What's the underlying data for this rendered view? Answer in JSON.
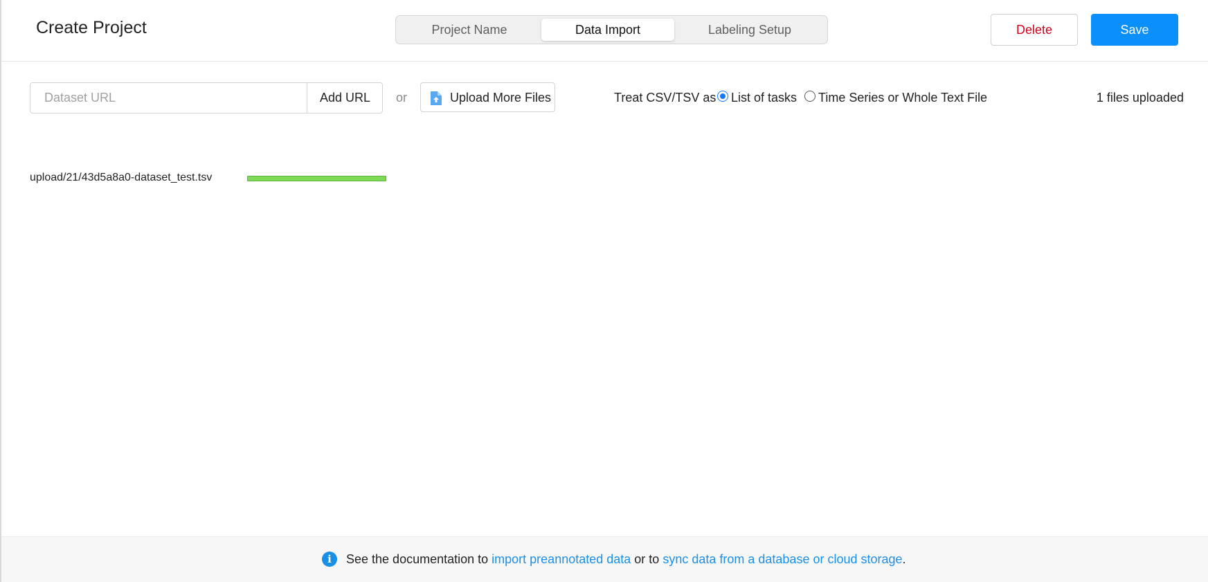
{
  "header": {
    "title": "Create Project",
    "tabs": [
      {
        "label": "Project Name",
        "active": false
      },
      {
        "label": "Data Import",
        "active": true
      },
      {
        "label": "Labeling Setup",
        "active": false
      }
    ],
    "delete_label": "Delete",
    "save_label": "Save"
  },
  "import": {
    "url_placeholder": "Dataset URL",
    "url_value": "",
    "add_url_label": "Add URL",
    "or_label": "or",
    "upload_label": "Upload More Files",
    "upload_icon": "file-upload-icon",
    "treat_label": "Treat CSV/TSV as",
    "options": [
      {
        "label": "List of tasks",
        "selected": true
      },
      {
        "label": "Time Series or Whole Text File",
        "selected": false
      }
    ],
    "files_count_label": "1 files uploaded"
  },
  "files": [
    {
      "name": "upload/21/43d5a8a0-dataset_test.tsv",
      "progress_percent": 100
    }
  ],
  "footer": {
    "info_icon": "info-icon",
    "prefix": "See the documentation to ",
    "link1": "import preannotated data",
    "middle": " or to ",
    "link2": "sync data from a database or cloud storage",
    "suffix": "."
  },
  "colors": {
    "accent": "#0a8ffb",
    "delete": "#d0021b",
    "link": "#1a8fe6",
    "progress": "#7ed957"
  }
}
